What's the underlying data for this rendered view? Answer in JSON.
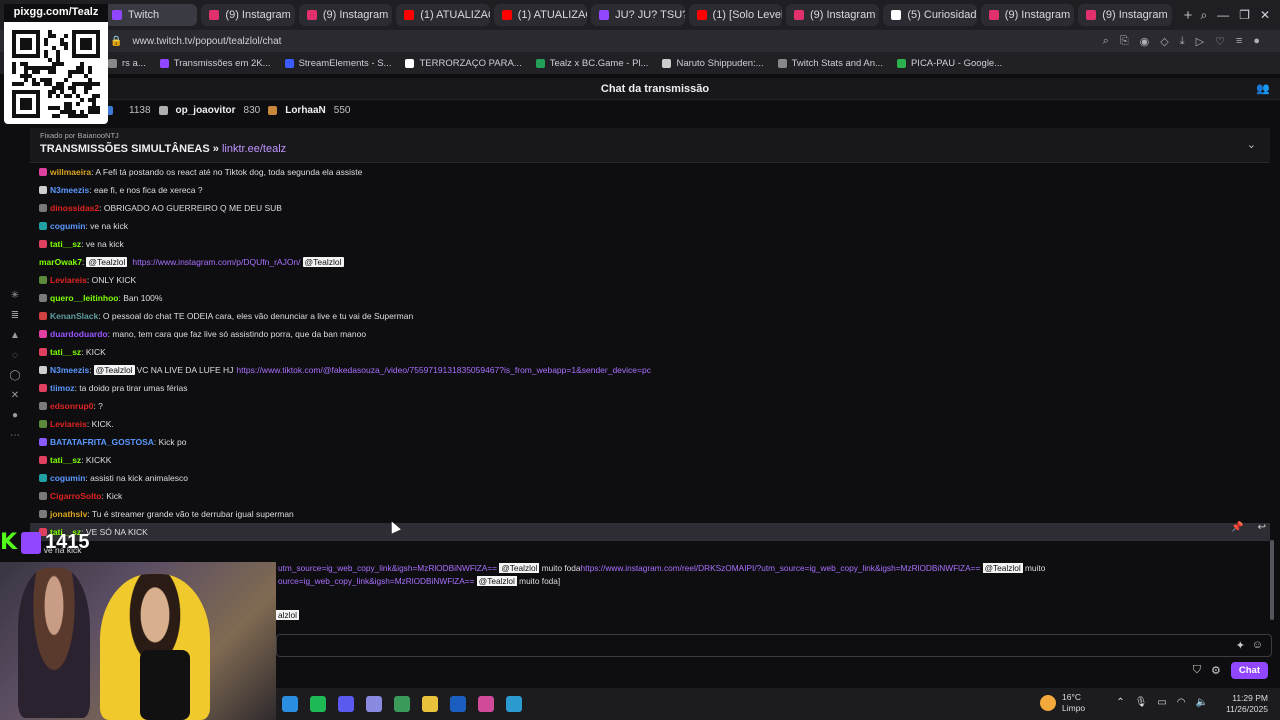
{
  "browser": {
    "tabs": [
      {
        "label": "Twitch",
        "color": "#9147ff"
      },
      {
        "label": "(9) Instagram",
        "color": "#e1306c"
      },
      {
        "label": "(9) Instagram",
        "color": "#e1306c"
      },
      {
        "label": "(1) ATUALIZAÇÃO D",
        "color": "#ff0000"
      },
      {
        "label": "(1) ATUALIZAÇÃO D",
        "color": "#ff0000"
      },
      {
        "label": "JU? JU? TSU?",
        "color": "#9147ff"
      },
      {
        "label": "(1) [Solo Leveling:AR",
        "color": "#ff0000"
      },
      {
        "label": "(9) Instagram",
        "color": "#e1306c"
      },
      {
        "label": "(5) Curiosidades Eur",
        "color": "#ffffff"
      },
      {
        "label": "(9) Instagram",
        "color": "#e1306c"
      },
      {
        "label": "(9) Instagram",
        "color": "#e1306c"
      }
    ],
    "new_tab": "+",
    "url": "www.twitch.tv/popout/tealzlol/chat",
    "bookmarks": [
      {
        "label": "rs a...",
        "color": "#888"
      },
      {
        "label": "Transmissões em 2K...",
        "color": "#9147ff"
      },
      {
        "label": "StreamElements - S...",
        "color": "#3b5bff"
      },
      {
        "label": "TERRORZAÇO PARA...",
        "color": "#ffffff"
      },
      {
        "label": "Tealz x BC.Game - Pl...",
        "color": "#22a05a"
      },
      {
        "label": "Naruto Shippuden:...",
        "color": "#cccccc"
      },
      {
        "label": "Twitch Stats and An...",
        "color": "#888"
      },
      {
        "label": "PICA-PAU - Google...",
        "color": "#2bb24c"
      }
    ]
  },
  "chat": {
    "header_title": "Chat da transmissão",
    "leaderboard": [
      {
        "name": "",
        "count": "1138",
        "color": "#3c7bd6"
      },
      {
        "name": "op_joaovitor",
        "count": "830",
        "color": "#b0b0b0"
      },
      {
        "name": "LorhaaN",
        "count": "550",
        "color": "#c8873a"
      }
    ],
    "pinned_by": "Fixado por BaianooNTJ",
    "pinned_text": "TRANSMISSÕES SIMULTÂNEAS »",
    "pinned_link": "linktr.ee/tealz",
    "messages": [
      {
        "user": "willmaeira",
        "color": "#daa520",
        "text": ": A Fefi tá postando os react até no Tiktok dog, toda segunda ela assiste",
        "badge": "#e040a0"
      },
      {
        "user": "N3meezis",
        "color": "#5b99ff",
        "text": ": eae fi, e nos fica de xereca ?",
        "badge": "#cfcfcf"
      },
      {
        "user": "dinossidas2",
        "color": "#e22222",
        "text": ": OBRIGADO AO GUERREIRO Q ME DEU SUB",
        "badge": "#7a7a7a"
      },
      {
        "user": "cogumin",
        "color": "#5b99ff",
        "text": ": ve na kick",
        "badge": "#20a0a0"
      },
      {
        "user": "tati__sz",
        "color": "#7fff00",
        "text": ": ve na kick",
        "badge": "#e04060"
      },
      {
        "user": "marOwak7",
        "color": "#7fff00",
        "text": ":",
        "mention": "@Tealzlol",
        "link": "https://www.instagram.com/p/DQUfn_rAJOn/",
        "mention2": "@Tealzlol",
        "badge": ""
      },
      {
        "user": "Leviareis",
        "color": "#e22222",
        "text": ": ONLY KICK",
        "badge": "#5a8a3a"
      },
      {
        "user": "quero__leitinhoo",
        "color": "#7fff00",
        "text": ": Ban 100%",
        "badge": "#7a7a7a"
      },
      {
        "user": "KenanSlack",
        "color": "#5f9ea0",
        "text": ": O pessoal do chat TE ODEIA cara, eles vão denunciar a live e tu vai de Superman",
        "badge": "#d04040"
      },
      {
        "user": "duardoduardo",
        "color": "#9a55ff",
        "text": ": mano, tem cara que faz live só assistindo porra, que da ban manoo",
        "badge": "#e040a0"
      },
      {
        "user": "tati__sz",
        "color": "#7fff00",
        "text": ": KICK",
        "badge": "#e04060"
      },
      {
        "user": "N3meezis",
        "color": "#5b99ff",
        "text": ":",
        "mention": "@Tealzlol",
        "text2": " VC NA LIVE DA LUFE HJ",
        "link": "https://www.tiktok.com/@fakedasouza_/video/7559719131835059467?is_from_webapp=1&sender_device=pc",
        "badge": "#cfcfcf"
      },
      {
        "user": "tiimoz",
        "color": "#5b99ff",
        "text": ": ta doido pra tirar umas férias",
        "badge": "#e04060"
      },
      {
        "user": "edsonrup0",
        "color": "#e22222",
        "text": ": ?",
        "badge": "#7a7a7a"
      },
      {
        "user": "Leviareis",
        "color": "#e22222",
        "text": ": KICK.",
        "badge": "#5a8a3a"
      },
      {
        "user": "BATATAFRITA_GOSTOSA",
        "color": "#5b99ff",
        "text": ": Kick po",
        "badge": "#8a5aff"
      },
      {
        "user": "tati__sz",
        "color": "#7fff00",
        "text": ": KICKK",
        "badge": "#e04060"
      },
      {
        "user": "cogumin",
        "color": "#5b99ff",
        "text": ": assisti na kick animalesco",
        "badge": "#20a0a0"
      },
      {
        "user": "CigarroSolto",
        "color": "#e22222",
        "text": ": Kick",
        "badge": "#7a7a7a"
      },
      {
        "user": "jonathslv",
        "color": "#daa520",
        "text": ": Tu é streamer grande vão te derrubar igual superman",
        "badge": "#7a7a7a"
      },
      {
        "user": "tati__sz",
        "color": "#7fff00",
        "text": ": VE SÓ NA KICK",
        "badge": "#e04060"
      },
      {
        "user": "",
        "color": "#e22222",
        "text": ": ve na kick",
        "badge": ""
      }
    ],
    "long_line1_link": "utm_source=ig_web_copy_link&igsh=MzRlODBiNWFlZA==",
    "long_line1_mention": "@Tealzlol",
    "long_line1_text": " muito foda",
    "long_line1_link2": "https://www.instagram.com/reel/DRKSzOMAIPI/?utm_source=ig_web_copy_link&igsh=MzRlODBiNWFlZA==",
    "long_line1_mention2": "@Tealzlol",
    "long_line1_tail": " muito",
    "long_line2_link": "ource=ig_web_copy_link&igsh=MzRlODBiNWFlZA==",
    "long_line2_mention": "@Tealzlol",
    "long_line2_tail": " muito foda]",
    "partial_mention": "alzlol",
    "chat_button": "Chat"
  },
  "taskbar": {
    "apps": [
      "#2a8de0",
      "#1db954",
      "#5a5af0",
      "#8a8ae0",
      "#3a9a5a",
      "#e8c23a",
      "#1a5fc0",
      "#d04a9a",
      "#2a9ad0"
    ],
    "weather_temp": "16°C",
    "weather_desc": "Limpo",
    "time": "11:29 PM",
    "date": "11/26/2025"
  },
  "overlay": {
    "qr_label": "pixgg.com/Tealz",
    "viewer_count": "1415",
    "kick_letter": "K"
  }
}
